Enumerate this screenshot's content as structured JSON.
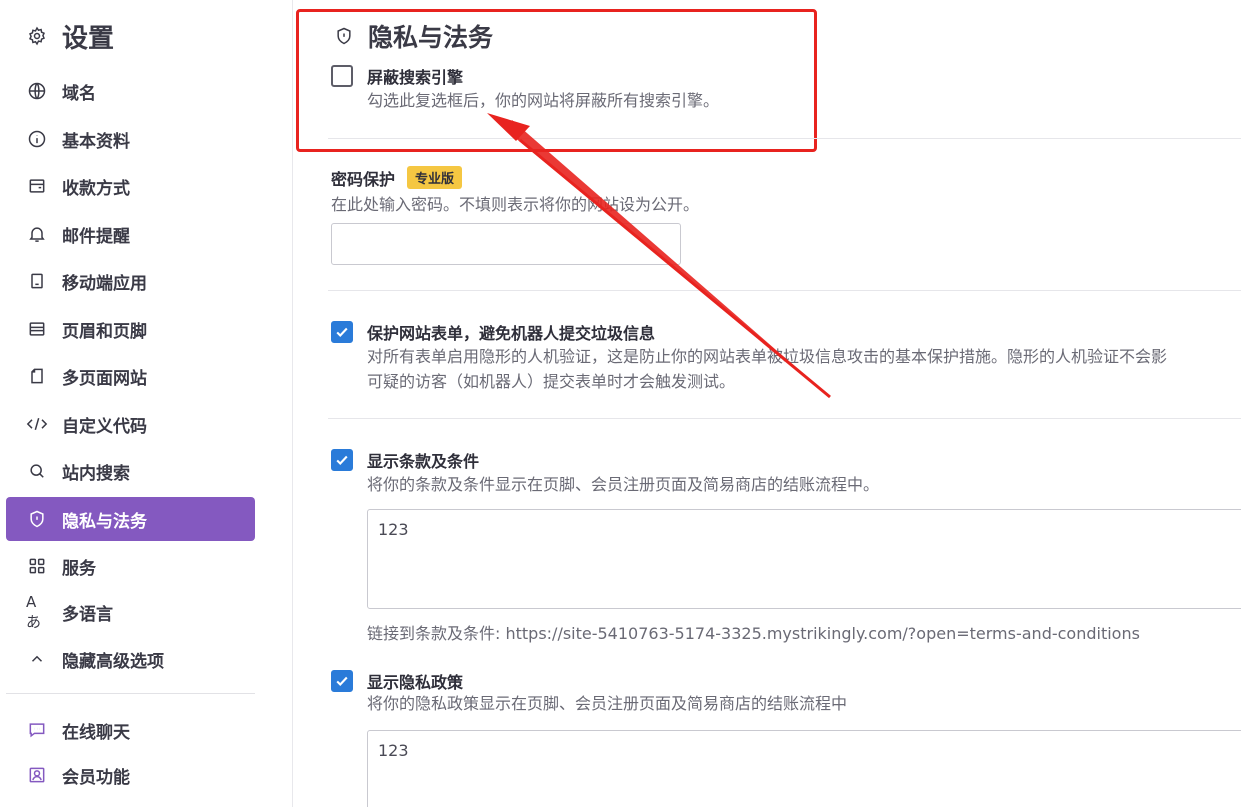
{
  "sidebar": {
    "title": "设置",
    "items": [
      {
        "label": "域名",
        "icon": "globe-icon"
      },
      {
        "label": "基本资料",
        "icon": "info-icon"
      },
      {
        "label": "收款方式",
        "icon": "wallet-icon"
      },
      {
        "label": "邮件提醒",
        "icon": "bell-icon"
      },
      {
        "label": "移动端应用",
        "icon": "mobile-icon"
      },
      {
        "label": "页眉和页脚",
        "icon": "layout-icon"
      },
      {
        "label": "多页面网站",
        "icon": "pages-icon"
      },
      {
        "label": "自定义代码",
        "icon": "code-icon"
      },
      {
        "label": "站内搜索",
        "icon": "search-icon"
      },
      {
        "label": "隐私与法务",
        "icon": "shield-icon",
        "active": true
      },
      {
        "label": "服务",
        "icon": "grid-icon"
      },
      {
        "label": "多语言",
        "icon": "translate-icon"
      },
      {
        "label": "隐藏高级选项",
        "icon": "chevron-up-icon"
      }
    ],
    "bottom_items": [
      {
        "label": "在线聊天",
        "icon": "chat-icon"
      },
      {
        "label": "会员功能",
        "icon": "member-icon"
      }
    ]
  },
  "main": {
    "section_title": "隐私与法务",
    "block_search": {
      "title": "屏蔽搜索引擎",
      "description": "勾选此复选框后，你的网站将屏蔽所有搜索引擎。",
      "checked": false
    },
    "password": {
      "title": "密码保护",
      "badge": "专业版",
      "description": "在此处输入密码。不填则表示将你的网站设为公开。",
      "value": ""
    },
    "protect_forms": {
      "title": "保护网站表单，避免机器人提交垃圾信息",
      "description_line1": "对所有表单启用隐形的人机验证，这是防止你的网站表单被垃圾信息攻击的基本保护措施。隐形的人机验证不会影",
      "description_line2": "可疑的访客（如机器人）提交表单时才会触发测试。",
      "checked": true
    },
    "terms": {
      "title": "显示条款及条件",
      "description": "将你的条款及条件显示在页脚、会员注册页面及简易商店的结账流程中。",
      "text_value": "123",
      "link_text": "链接到条款及条件: https://site-5410763-5174-3325.mystrikingly.com/?open=terms-and-conditions",
      "checked": true
    },
    "privacy": {
      "title": "显示隐私政策",
      "description": "将你的隐私政策显示在页脚、会员注册页面及简易商店的结账流程中",
      "text_value": "123",
      "checked": true
    }
  },
  "colors": {
    "accent": "#8459c0",
    "checkbox": "#2a7bd9",
    "badge": "#f5c742",
    "annotation": "#e8231f"
  }
}
